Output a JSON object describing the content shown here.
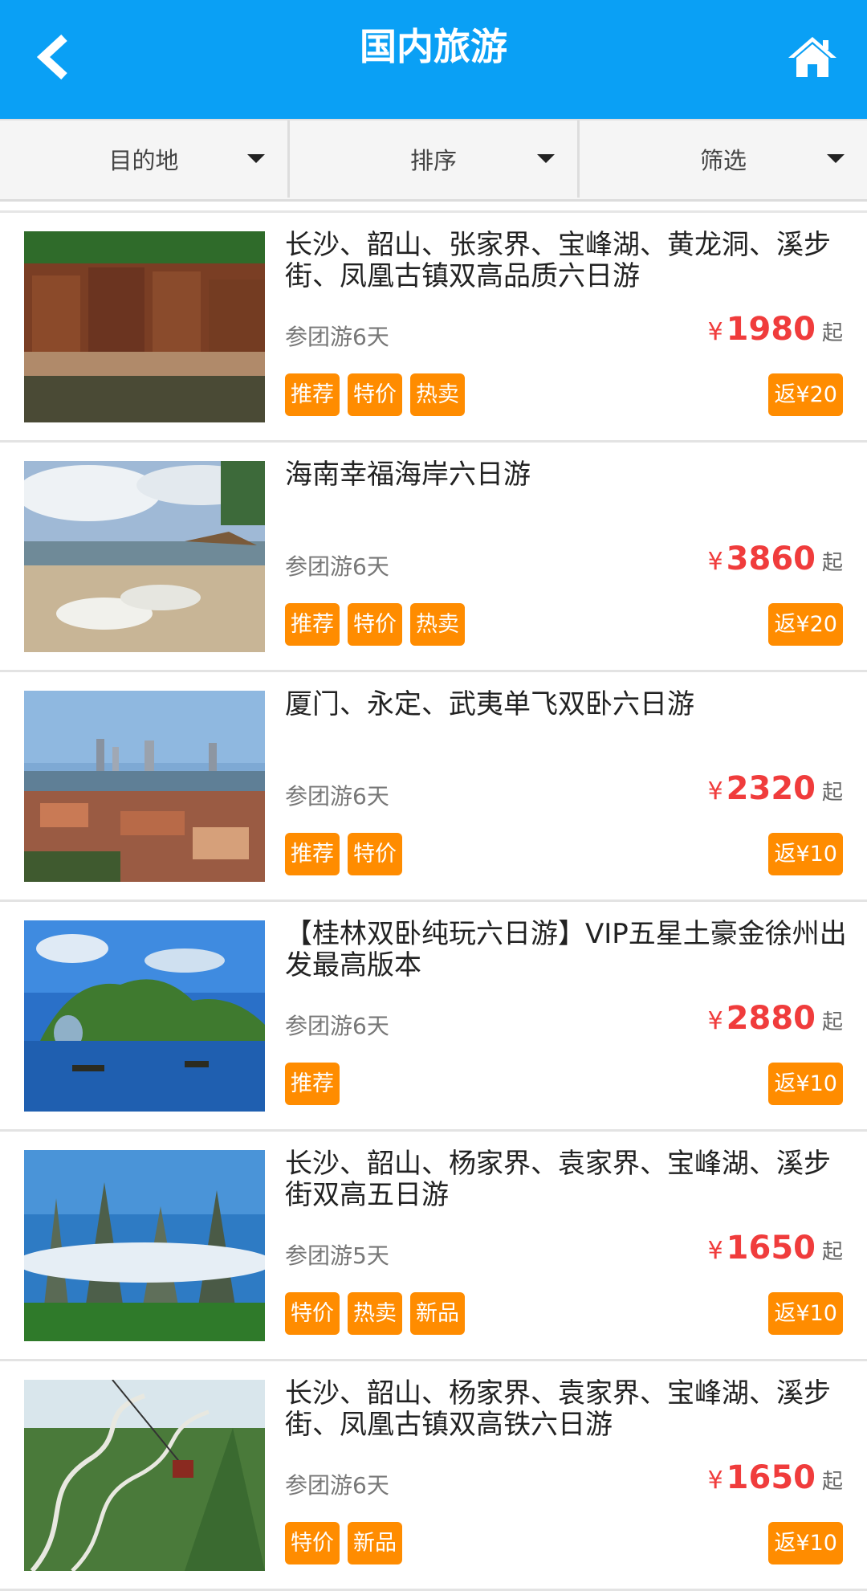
{
  "header": {
    "title": "国内旅游",
    "bg_color": "#0aa0f5",
    "back_icon": "chevron-left-icon",
    "home_icon": "home-icon"
  },
  "filters": [
    {
      "label": "目的地"
    },
    {
      "label": "排序"
    },
    {
      "label": "筛选"
    }
  ],
  "accent_color": "#ff8c00",
  "price_color": "#f03c3c",
  "items": [
    {
      "title": "长沙、韶山、张家界、宝峰湖、黄龙洞、溪步街、凤凰古镇双高品质六日游",
      "duration": "参团游6天",
      "currency": "¥",
      "price": "1980",
      "price_suffix": "起",
      "tags": [
        "推荐",
        "特价",
        "热卖"
      ],
      "rebate": "返¥20"
    },
    {
      "title": "海南幸福海岸六日游",
      "duration": "参团游6天",
      "currency": "¥",
      "price": "3860",
      "price_suffix": "起",
      "tags": [
        "推荐",
        "特价",
        "热卖"
      ],
      "rebate": "返¥20"
    },
    {
      "title": "厦门、永定、武夷单飞双卧六日游",
      "duration": "参团游6天",
      "currency": "¥",
      "price": "2320",
      "price_suffix": "起",
      "tags": [
        "推荐",
        "特价"
      ],
      "rebate": "返¥10"
    },
    {
      "title": "【桂林双卧纯玩六日游】VIP五星土豪金徐州出发最高版本",
      "duration": "参团游6天",
      "currency": "¥",
      "price": "2880",
      "price_suffix": "起",
      "tags": [
        "推荐"
      ],
      "rebate": "返¥10"
    },
    {
      "title": "长沙、韶山、杨家界、袁家界、宝峰湖、溪步街双高五日游",
      "duration": "参团游5天",
      "currency": "¥",
      "price": "1650",
      "price_suffix": "起",
      "tags": [
        "特价",
        "热卖",
        "新品"
      ],
      "rebate": "返¥10"
    },
    {
      "title": "长沙、韶山、杨家界、袁家界、宝峰湖、溪步街、凤凰古镇双高铁六日游",
      "duration": "参团游6天",
      "currency": "¥",
      "price": "1650",
      "price_suffix": "起",
      "tags": [
        "特价",
        "新品"
      ],
      "rebate": "返¥10"
    }
  ]
}
